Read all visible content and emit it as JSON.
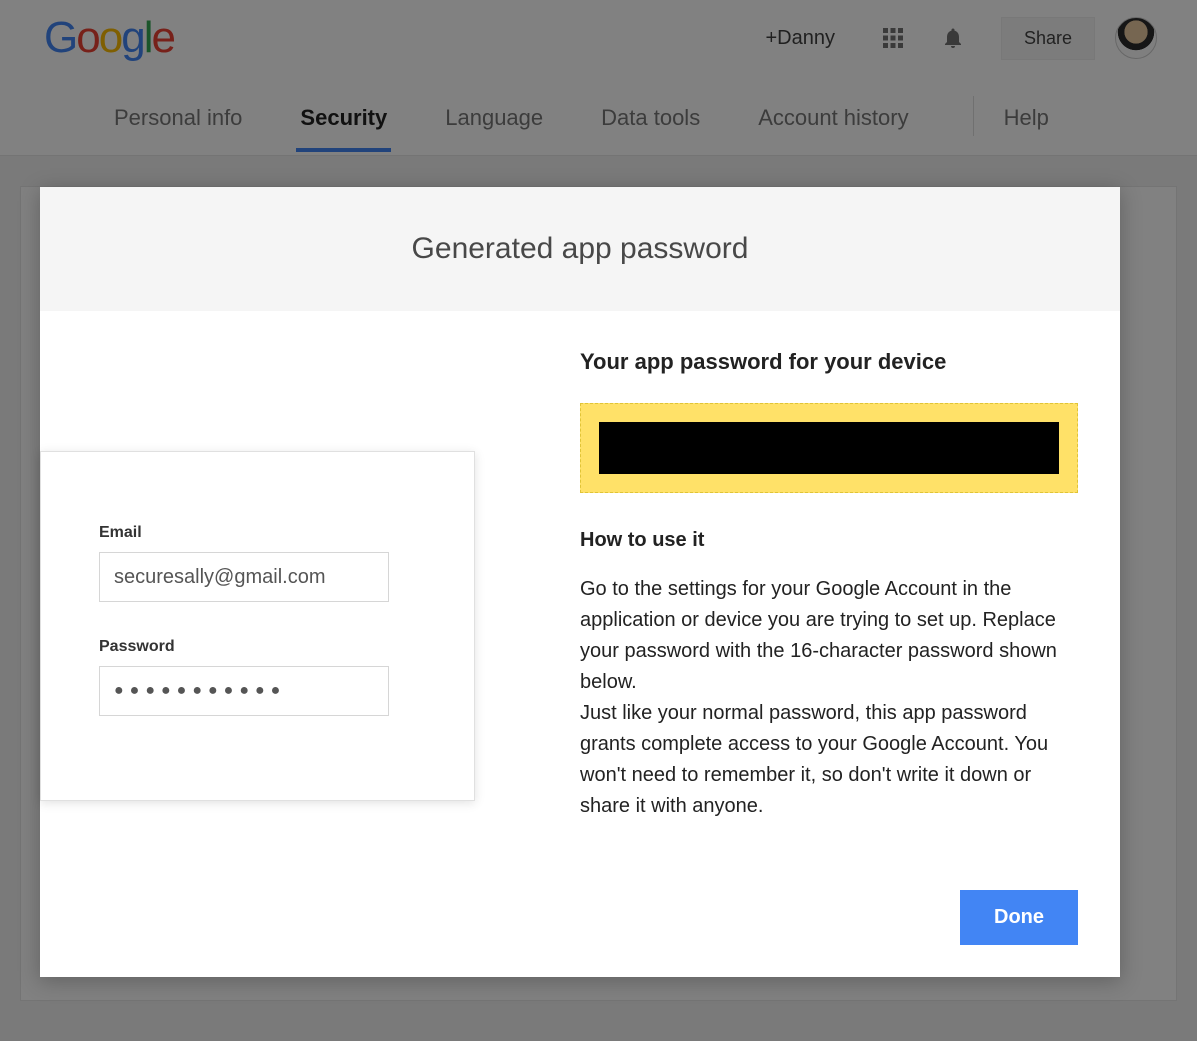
{
  "header": {
    "logo_letters": [
      "G",
      "o",
      "o",
      "g",
      "l",
      "e"
    ],
    "plus_user": "+Danny",
    "share_label": "Share"
  },
  "tabs": {
    "items": [
      {
        "label": "Personal info",
        "active": false
      },
      {
        "label": "Security",
        "active": true
      },
      {
        "label": "Language",
        "active": false
      },
      {
        "label": "Data tools",
        "active": false
      },
      {
        "label": "Account history",
        "active": false
      }
    ],
    "help_label": "Help"
  },
  "modal": {
    "title": "Generated app password",
    "right": {
      "heading": "Your app password for your device",
      "how_heading": "How to use it",
      "instructions": "Go to the settings for your Google Account in the application or device you are trying to set up. Replace your password with the 16-character password shown below.\nJust like your normal password, this app password grants complete access to your Google Account. You won't need to remember it, so don't write it down or share it with anyone.",
      "done_label": "Done"
    },
    "demo": {
      "email_label": "Email",
      "email_value": "securesally@gmail.com",
      "password_label": "Password",
      "password_masked": "●●●●●●●●●●●"
    }
  }
}
